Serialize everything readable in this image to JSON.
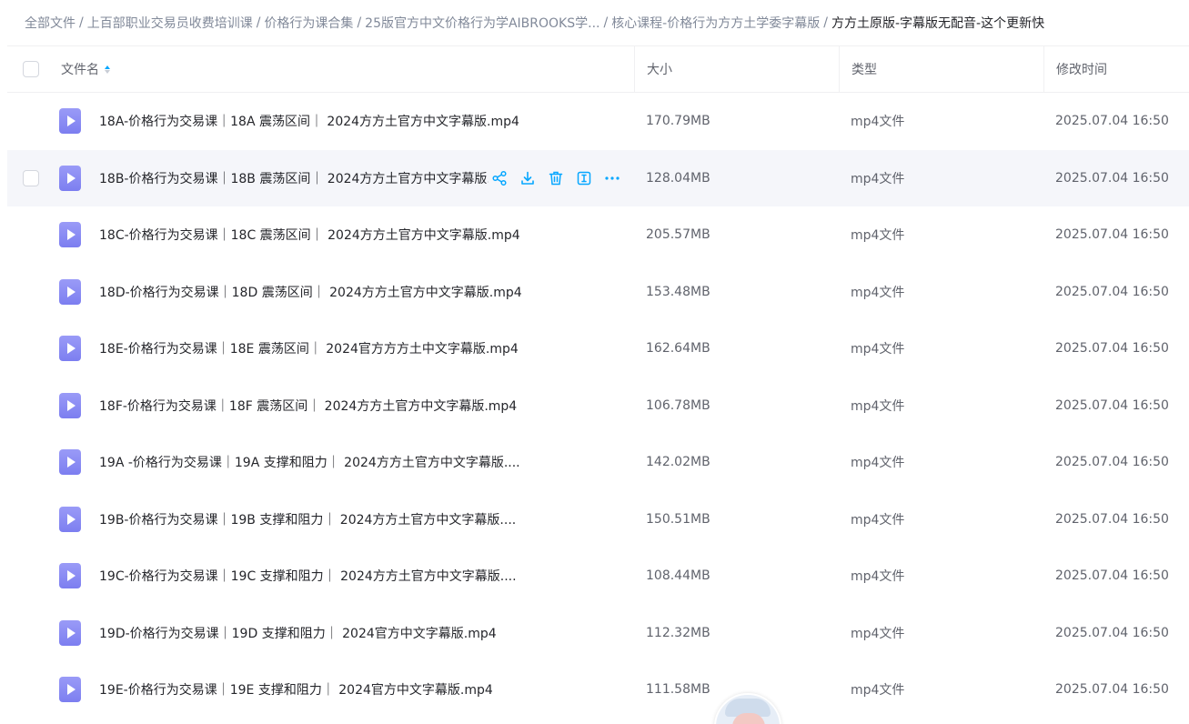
{
  "breadcrumb": [
    {
      "label": "全部文件"
    },
    {
      "label": "上百部职业交易员收费培训课"
    },
    {
      "label": "价格行为课合集"
    },
    {
      "label": "25版官方中文价格行为学AIBROOKS学..."
    },
    {
      "label": "核心课程-价格行为方方土学委字幕版"
    },
    {
      "label": "方方土原版-字幕版无配音-这个更新快"
    }
  ],
  "breadcrumb_sep": "/",
  "table": {
    "headers": {
      "name": "文件名",
      "size": "大小",
      "type": "类型",
      "time": "修改时间"
    },
    "rows": [
      {
        "name": "18A-价格行为交易课｜18A 震荡区间｜ 2024方方土官方中文字幕版.mp4",
        "size": "170.79MB",
        "type": "mp4文件",
        "time": "2025.07.04 16:50"
      },
      {
        "name": "18B-价格行为交易课｜18B 震荡区间｜ 2024方方土官方中文字幕版.mp4",
        "size": "128.04MB",
        "type": "mp4文件",
        "time": "2025.07.04 16:50"
      },
      {
        "name": "18C-价格行为交易课｜18C 震荡区间｜ 2024方方土官方中文字幕版.mp4",
        "size": "205.57MB",
        "type": "mp4文件",
        "time": "2025.07.04 16:50"
      },
      {
        "name": "18D-价格行为交易课｜18D 震荡区间｜ 2024方方土官方中文字幕版.mp4",
        "size": "153.48MB",
        "type": "mp4文件",
        "time": "2025.07.04 16:50"
      },
      {
        "name": "18E-价格行为交易课｜18E 震荡区间｜ 2024官方方方土中文字幕版.mp4",
        "size": "162.64MB",
        "type": "mp4文件",
        "time": "2025.07.04 16:50"
      },
      {
        "name": "18F-价格行为交易课｜18F 震荡区间｜ 2024方方土官方中文字幕版.mp4",
        "size": "106.78MB",
        "type": "mp4文件",
        "time": "2025.07.04 16:50"
      },
      {
        "name": "19A -价格行为交易课｜19A 支撑和阻力｜ 2024方方土官方中文字幕版....",
        "size": "142.02MB",
        "type": "mp4文件",
        "time": "2025.07.04 16:50"
      },
      {
        "name": "19B-价格行为交易课｜19B 支撑和阻力｜ 2024方方土官方中文字幕版....",
        "size": "150.51MB",
        "type": "mp4文件",
        "time": "2025.07.04 16:50"
      },
      {
        "name": "19C-价格行为交易课｜19C 支撑和阻力｜ 2024方方土官方中文字幕版....",
        "size": "108.44MB",
        "type": "mp4文件",
        "time": "2025.07.04 16:50"
      },
      {
        "name": "19D-价格行为交易课｜19D 支撑和阻力｜ 2024官方中文字幕版.mp4",
        "size": "112.32MB",
        "type": "mp4文件",
        "time": "2025.07.04 16:50"
      },
      {
        "name": "19E-价格行为交易课｜19E 支撑和阻力｜ 2024官方中文字幕版.mp4",
        "size": "111.58MB",
        "type": "mp4文件",
        "time": "2025.07.04 16:50"
      }
    ],
    "hover_row_index": 1,
    "row_actions": [
      "share-icon",
      "download-icon",
      "delete-icon",
      "rename-icon",
      "more-icon"
    ]
  },
  "colors": {
    "accent": "#06a7ff",
    "file_icon": "#8a8cf4",
    "text_primary": "#25262b",
    "text_secondary": "#818999",
    "hover_row": "#f5f6fa",
    "divider": "#f0f0f2"
  }
}
